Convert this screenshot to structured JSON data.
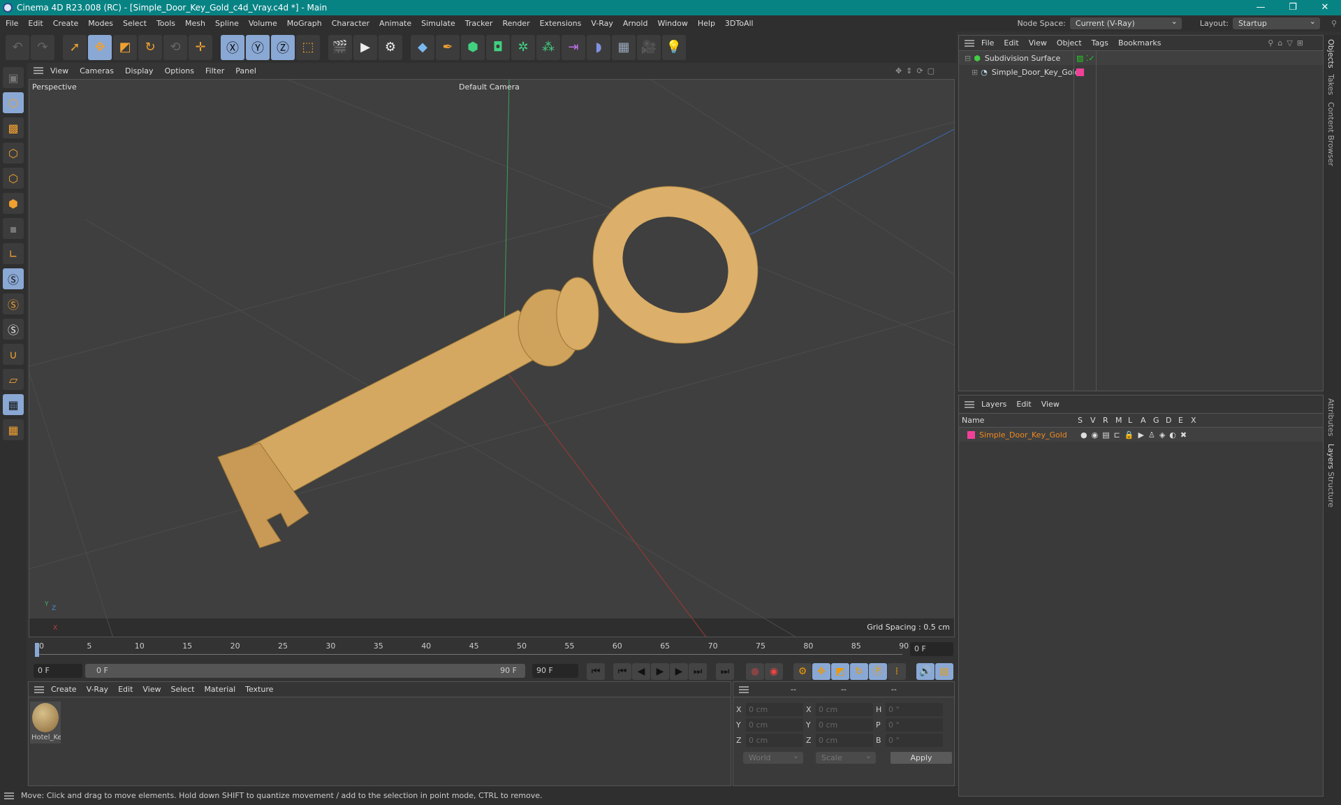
{
  "window": {
    "title": "Cinema 4D R23.008 (RC) - [Simple_Door_Key_Gold_c4d_Vray.c4d *] - Main",
    "minimize": "—",
    "restore": "❐",
    "close": "✕"
  },
  "menu": [
    "File",
    "Edit",
    "Create",
    "Modes",
    "Select",
    "Tools",
    "Mesh",
    "Spline",
    "Volume",
    "MoGraph",
    "Character",
    "Animate",
    "Simulate",
    "Tracker",
    "Render",
    "Extensions",
    "V-Ray",
    "Arnold",
    "Window",
    "Help",
    "3DToAll"
  ],
  "node_space": {
    "label": "Node Space:",
    "value": "Current (V-Ray)"
  },
  "layout": {
    "label": "Layout:",
    "value": "Startup"
  },
  "viewport": {
    "menu": [
      "View",
      "Cameras",
      "Display",
      "Options",
      "Filter",
      "Panel"
    ],
    "view_name": "Perspective",
    "camera": "Default Camera",
    "grid_spacing": "Grid Spacing : 0.5 cm",
    "axis_labels": {
      "x": "X",
      "y": "Y",
      "z": "Z"
    }
  },
  "timeline": {
    "ticks": [
      "0",
      "5",
      "10",
      "15",
      "20",
      "25",
      "30",
      "35",
      "40",
      "45",
      "50",
      "55",
      "60",
      "65",
      "70",
      "75",
      "80",
      "85",
      "90"
    ],
    "current_frame": "0 F",
    "start": "0 F",
    "range_start": "0 F",
    "range_end": "90 F",
    "end": "90 F"
  },
  "material_panel": {
    "menu": [
      "Create",
      "V-Ray",
      "Edit",
      "View",
      "Select",
      "Material",
      "Texture"
    ],
    "materials": [
      {
        "name": "Hotel_Ke"
      }
    ]
  },
  "coordinates": {
    "headers": [
      "--",
      "--",
      "--"
    ],
    "rows": [
      {
        "l1": "X",
        "v1": "0 cm",
        "l2": "X",
        "v2": "0 cm",
        "l3": "H",
        "v3": "0 °"
      },
      {
        "l1": "Y",
        "v1": "0 cm",
        "l2": "Y",
        "v2": "0 cm",
        "l3": "P",
        "v3": "0 °"
      },
      {
        "l1": "Z",
        "v1": "0 cm",
        "l2": "Z",
        "v2": "0 cm",
        "l3": "B",
        "v3": "0 °"
      }
    ],
    "space": "World",
    "mode": "Scale",
    "apply": "Apply"
  },
  "status": "Move: Click and drag to move elements. Hold down SHIFT to quantize movement / add to the selection in point mode, CTRL to remove.",
  "objects_panel": {
    "menu": [
      "File",
      "Edit",
      "View",
      "Object",
      "Tags",
      "Bookmarks"
    ],
    "items": [
      {
        "name": "Subdivision Surface"
      },
      {
        "name": "Simple_Door_Key_Gold",
        "color": "#f0409a"
      }
    ]
  },
  "layers_panel": {
    "menu": [
      "Layers",
      "Edit",
      "View"
    ],
    "columns": [
      "Name",
      "S",
      "V",
      "R",
      "M",
      "L",
      "A",
      "G",
      "D",
      "E",
      "X"
    ],
    "layers": [
      {
        "name": "Simple_Door_Key_Gold",
        "color": "#f0409a",
        "text_color": "#f08a20"
      }
    ]
  },
  "side_tabs": [
    "Objects",
    "Takes",
    "Content Browser",
    "Attributes",
    "Layers",
    "Structure"
  ],
  "colors": {
    "titlebar": "#088384",
    "accent_selected": "#8aa8d4",
    "icon_orange": "#f0a030",
    "key_gold": "#d8ac64"
  }
}
